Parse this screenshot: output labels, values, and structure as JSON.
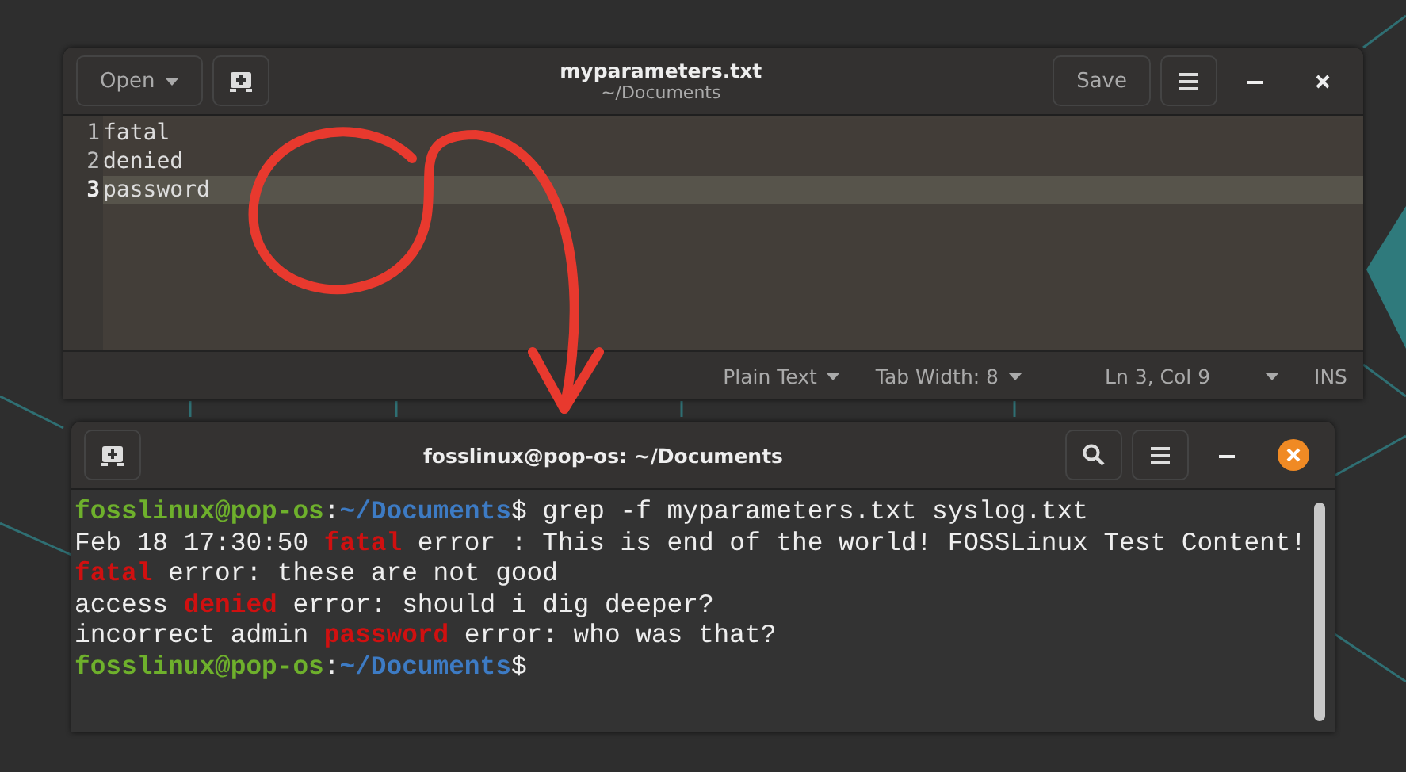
{
  "editor": {
    "open_button": "Open",
    "title": "myparameters.txt",
    "subtitle": "~/Documents",
    "save_button": "Save",
    "lines": [
      {
        "number": "1",
        "text": "fatal",
        "selected": false
      },
      {
        "number": "2",
        "text": "denied",
        "selected": false
      },
      {
        "number": "3",
        "text": "password",
        "selected": true
      }
    ],
    "status_bar": {
      "language": "Plain Text",
      "tab_width": "Tab Width: 8",
      "position": "Ln 3, Col 9",
      "mode": "INS"
    }
  },
  "terminal": {
    "title": "fosslinux@pop-os: ~/Documents",
    "lines": [
      {
        "segments": [
          {
            "kind": "user",
            "text": "fosslinux@pop-os"
          },
          {
            "kind": "plain",
            "text": ":"
          },
          {
            "kind": "path",
            "text": "~/Documents"
          },
          {
            "kind": "plain",
            "text": "$ grep -f myparameters.txt syslog.txt"
          }
        ]
      },
      {
        "segments": [
          {
            "kind": "plain",
            "text": "Feb 18 17:30:50 "
          },
          {
            "kind": "match",
            "text": "fatal"
          },
          {
            "kind": "plain",
            "text": " error : This is end of the world! FOSSLinux Test Content!"
          }
        ]
      },
      {
        "segments": [
          {
            "kind": "match",
            "text": "fatal"
          },
          {
            "kind": "plain",
            "text": " error: these are not good"
          }
        ]
      },
      {
        "segments": [
          {
            "kind": "plain",
            "text": "access "
          },
          {
            "kind": "match",
            "text": "denied"
          },
          {
            "kind": "plain",
            "text": " error: should i dig deeper?"
          }
        ]
      },
      {
        "segments": [
          {
            "kind": "plain",
            "text": "incorrect admin "
          },
          {
            "kind": "match",
            "text": "password"
          },
          {
            "kind": "plain",
            "text": " error: who was that?"
          }
        ]
      },
      {
        "segments": [
          {
            "kind": "user",
            "text": "fosslinux@pop-os"
          },
          {
            "kind": "plain",
            "text": ":"
          },
          {
            "kind": "path",
            "text": "~/Documents"
          },
          {
            "kind": "plain",
            "text": "$"
          }
        ]
      }
    ]
  }
}
